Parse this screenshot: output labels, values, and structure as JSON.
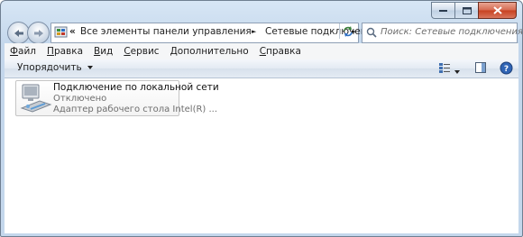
{
  "window": {
    "caption_buttons": [
      "minimize",
      "maximize",
      "close"
    ]
  },
  "address_bar": {
    "overflow": "«",
    "crumbs": [
      "Все элементы панели управления",
      "Сетевые подключения"
    ],
    "separator": "►"
  },
  "search": {
    "placeholder": "Поиск: Сетевые подключения"
  },
  "menu": {
    "items": [
      {
        "label": "Файл",
        "access": "Ф",
        "rest": "айл"
      },
      {
        "label": "Правка",
        "access": "П",
        "rest": "равка"
      },
      {
        "label": "Вид",
        "access": "В",
        "rest": "ид"
      },
      {
        "label": "Сервис",
        "access": "С",
        "rest": "ервис"
      },
      {
        "label": "Дополнительно",
        "access": "Д",
        "rest": "ополнительно"
      },
      {
        "label": "Справка",
        "access": "С",
        "rest": "правка"
      }
    ]
  },
  "command_bar": {
    "organize_label": "Упорядочить"
  },
  "connection": {
    "name": "Подключение по локальной сети",
    "status": "Отключено",
    "adapter": "Адаптер рабочего стола Intel(R) ..."
  }
}
